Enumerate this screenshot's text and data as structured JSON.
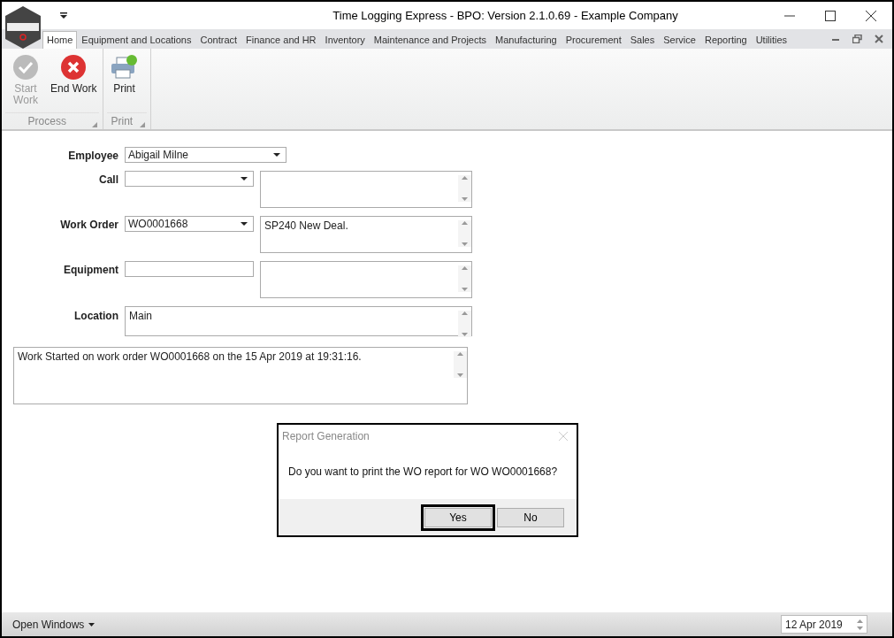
{
  "window": {
    "title": "Time Logging Express - BPO: Version 2.1.0.69 - Example Company"
  },
  "tabs": [
    {
      "label": "Home",
      "selected": true
    },
    {
      "label": "Equipment and Locations",
      "selected": false
    },
    {
      "label": "Contract",
      "selected": false
    },
    {
      "label": "Finance and HR",
      "selected": false
    },
    {
      "label": "Inventory",
      "selected": false
    },
    {
      "label": "Maintenance and Projects",
      "selected": false
    },
    {
      "label": "Manufacturing",
      "selected": false
    },
    {
      "label": "Procurement",
      "selected": false
    },
    {
      "label": "Sales",
      "selected": false
    },
    {
      "label": "Service",
      "selected": false
    },
    {
      "label": "Reporting",
      "selected": false
    },
    {
      "label": "Utilities",
      "selected": false
    }
  ],
  "ribbon_groups": [
    {
      "label": "Process",
      "buttons": [
        {
          "label": "Start Work",
          "kind": "start",
          "disabled": true
        },
        {
          "label": "End Work",
          "kind": "end",
          "disabled": false
        }
      ]
    },
    {
      "label": "Print",
      "buttons": [
        {
          "label": "Print",
          "kind": "print",
          "disabled": false
        }
      ]
    }
  ],
  "form": {
    "employee": {
      "label": "Employee",
      "value": "Abigail Milne"
    },
    "call": {
      "label": "Call"
    },
    "work_order": {
      "label": "Work Order",
      "value": "WO0001668",
      "memo": "SP240 New Deal."
    },
    "equipment": {
      "label": "Equipment"
    },
    "location": {
      "label": "Location",
      "memo": "Main"
    },
    "log": "Work Started on work order WO0001668 on the 15 Apr 2019 at 19:31:16."
  },
  "dialog": {
    "title": "Report Generation",
    "message": "Do you want to print the WO report for WO WO0001668?",
    "buttons": [
      {
        "label": "Yes",
        "selected": true
      },
      {
        "label": "No",
        "selected": false
      }
    ]
  },
  "status_bar": {
    "open_windows": "Open Windows",
    "date": "12 Apr 2019"
  }
}
